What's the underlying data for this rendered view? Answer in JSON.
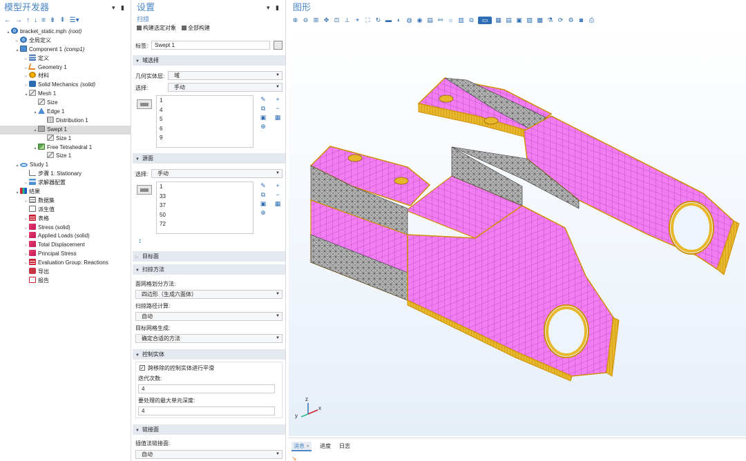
{
  "model_builder": {
    "title": "模型开发器",
    "toolbar_icons": [
      "back-arrow-icon",
      "forward-arrow-icon",
      "up-arrow-icon",
      "down-arrow-icon",
      "filter-icon",
      "expand-icon",
      "collapse-icon",
      "options-icon"
    ],
    "tree": [
      {
        "label": "bracket_static.mph",
        "tag": "(root)",
        "level": 0,
        "expand": "▴",
        "icon": "globe"
      },
      {
        "label": "全局定义",
        "tag": "",
        "level": 1,
        "expand": "▹",
        "icon": "globe"
      },
      {
        "label": "Component 1",
        "tag": "(comp1)",
        "level": 1,
        "expand": "▴",
        "icon": "comp"
      },
      {
        "label": "定义",
        "tag": "",
        "level": 2,
        "expand": "▹",
        "icon": "def"
      },
      {
        "label": "Geometry 1",
        "tag": "",
        "level": 2,
        "expand": "▹",
        "icon": "geom"
      },
      {
        "label": "材料",
        "tag": "",
        "level": 2,
        "expand": "▹",
        "icon": "mat"
      },
      {
        "label": "Solid Mechanics",
        "tag": "(solid)",
        "level": 2,
        "expand": "▹",
        "icon": "solid"
      },
      {
        "label": "Mesh 1",
        "tag": "",
        "level": 2,
        "expand": "▴",
        "icon": "mesh"
      },
      {
        "label": "Size",
        "tag": "",
        "level": 3,
        "expand": "",
        "icon": "mesh"
      },
      {
        "label": "Edge 1",
        "tag": "",
        "level": 3,
        "expand": "▴",
        "icon": "meshtri"
      },
      {
        "label": "Distribution 1",
        "tag": "",
        "level": 4,
        "expand": "",
        "icon": "grid"
      },
      {
        "label": "Swept 1",
        "tag": "",
        "level": 3,
        "expand": "▴",
        "icon": "swept",
        "selected": true
      },
      {
        "label": "Size 1",
        "tag": "",
        "level": 4,
        "expand": "",
        "icon": "mesh"
      },
      {
        "label": "Free Tetrahedral 1",
        "tag": "",
        "level": 3,
        "expand": "▴",
        "icon": "tet"
      },
      {
        "label": "Size 1",
        "tag": "",
        "level": 4,
        "expand": "",
        "icon": "mesh"
      },
      {
        "label": "Study 1",
        "tag": "",
        "level": 1,
        "expand": "▴",
        "icon": "study"
      },
      {
        "label": "步骤 1: Stationary",
        "tag": "",
        "level": 2,
        "expand": "",
        "icon": "step"
      },
      {
        "label": "求解器配置",
        "tag": "",
        "level": 2,
        "expand": "▹",
        "icon": "solver"
      },
      {
        "label": "结果",
        "tag": "",
        "level": 1,
        "expand": "▴",
        "icon": "results"
      },
      {
        "label": "数据集",
        "tag": "",
        "level": 2,
        "expand": "▹",
        "icon": "dataset"
      },
      {
        "label": "派生值",
        "tag": "",
        "level": 2,
        "expand": "",
        "icon": "derived"
      },
      {
        "label": "表格",
        "tag": "",
        "level": 2,
        "expand": "▹",
        "icon": "table"
      },
      {
        "label": "Stress (solid)",
        "tag": "",
        "level": 2,
        "expand": "▹",
        "icon": "plot"
      },
      {
        "label": "Applied Loads (solid)",
        "tag": "",
        "level": 2,
        "expand": "▹",
        "icon": "plot"
      },
      {
        "label": "Total Displacement",
        "tag": "",
        "level": 2,
        "expand": "▹",
        "icon": "plot"
      },
      {
        "label": "Principal Stress",
        "tag": "",
        "level": 2,
        "expand": "▹",
        "icon": "plot"
      },
      {
        "label": "Evaluation Group: Reactions",
        "tag": "",
        "level": 2,
        "expand": "▹",
        "icon": "table"
      },
      {
        "label": "导出",
        "tag": "",
        "level": 2,
        "expand": "",
        "icon": "export"
      },
      {
        "label": "报告",
        "tag": "",
        "level": 2,
        "expand": "",
        "icon": "report"
      }
    ]
  },
  "settings": {
    "title": "设置",
    "subtitle": "扫掠",
    "build_selected": "构建选定对象",
    "build_all": "全部构建",
    "label_caption": "标签:",
    "label_value": "Swept 1",
    "domain_section": "域选择",
    "geom_level_caption": "几何实体层:",
    "geom_level_value": "域",
    "selection_caption": "选择:",
    "selection_value": "手动",
    "domain_items": [
      "1",
      "4",
      "5",
      "6",
      "9"
    ],
    "source_section": "源面",
    "source_selection_caption": "选择:",
    "source_selection_value": "手动",
    "source_items": [
      "1",
      "33",
      "37",
      "50",
      "72"
    ],
    "dest_section": "目标面",
    "sweep_method_section": "扫掠方法",
    "face_meshing_caption": "面网格划分方法:",
    "face_meshing_value": "四边形（生成六面体）",
    "path_calc_caption": "扫掠路径计算:",
    "path_calc_value": "自动",
    "dest_mesh_caption": "目标网格生成:",
    "dest_mesh_value": "确定合适的方法",
    "control_section": "控制实体",
    "smooth_label": "跨移除的控制实体进行平滑",
    "iterations_caption": "迭代次数:",
    "iterations_value": "4",
    "depth_caption": "要处理的最大单元深度:",
    "depth_value": "4",
    "link_section": "链接面",
    "interp_caption": "插值法链接面:",
    "interp_value": "自动"
  },
  "graphics": {
    "title": "图形",
    "toolbar_icons": [
      "zoom-in-icon",
      "zoom-out-icon",
      "zoom-box-icon",
      "zoom-extents-icon",
      "fit-icon",
      "axis-icon",
      "select-icon",
      "view-icon",
      "reset-icon",
      "scene-light-icon",
      "transparency-icon",
      "wireframe-icon",
      "render-icon",
      "grid-icon",
      "camera-icon",
      "print-icon"
    ],
    "tabs": [
      "消息",
      "进度",
      "日志"
    ],
    "axes": {
      "x": "x",
      "y": "y",
      "z": "z"
    },
    "colors": {
      "face": "#f17cf3",
      "edge": "#d08f00",
      "rim": "#e8b82a",
      "tet": "#9a9a9a"
    }
  }
}
